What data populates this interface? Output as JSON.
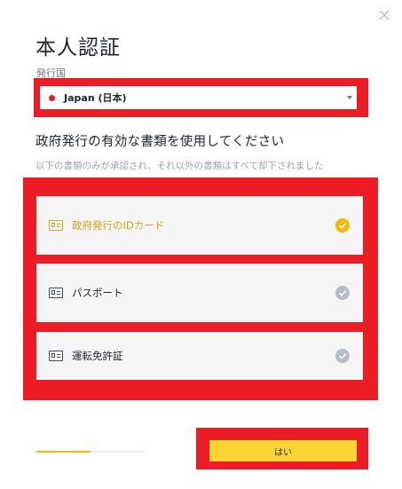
{
  "dialog": {
    "title": "本人認証",
    "close_icon": "close-icon"
  },
  "country": {
    "label": "発行国",
    "selected": "Japan (日本)",
    "flag_color": "#e4201f"
  },
  "documents": {
    "heading": "政府発行の有効な書類を使用してください",
    "note": "以下の書類のみが承認され、それ以外の書類はすべて却下されました",
    "items": [
      {
        "label": "政府発行のIDカード",
        "icon": "id-card-icon",
        "selected": true
      },
      {
        "label": "パスポート",
        "icon": "passport-icon",
        "selected": false
      },
      {
        "label": "運転免許証",
        "icon": "drivers-license-icon",
        "selected": false
      }
    ]
  },
  "footer": {
    "progress": 0.5,
    "confirm_label": "はい"
  },
  "colors": {
    "accent": "#f0b90b",
    "accent_text": "#d8a21c",
    "button": "#fcd535",
    "highlight": "#ec1c24",
    "check_inactive": "#b7bdc6"
  }
}
